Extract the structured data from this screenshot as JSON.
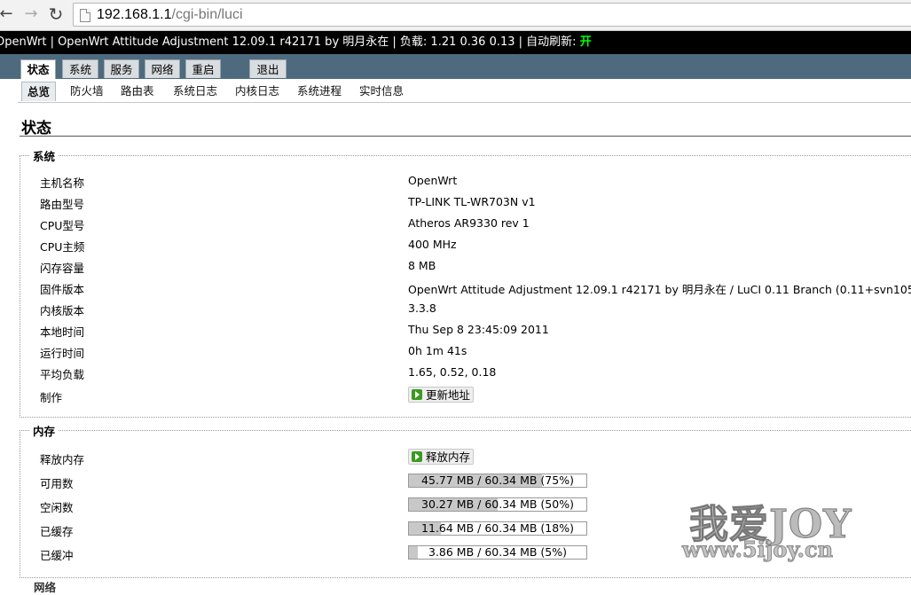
{
  "browser": {
    "url_host": "192.168.1.1",
    "url_path": "/cgi-bin/luci",
    "back_glyph": "←",
    "forward_glyph": "→",
    "reload_glyph": "↻"
  },
  "header": {
    "text": "OpenWrt | OpenWrt Attitude Adjustment 12.09.1 r42171 by 明月永在 | 负载: 1.21 0.36 0.13 | 自动刷新: ",
    "refresh_state": "开"
  },
  "menu": {
    "tabs": [
      {
        "label": "状态"
      },
      {
        "label": "系统"
      },
      {
        "label": "服务"
      },
      {
        "label": "网络"
      },
      {
        "label": "重启"
      },
      {
        "label": "退出"
      }
    ]
  },
  "submenu": {
    "tabs": [
      {
        "label": "总览"
      },
      {
        "label": "防火墙"
      },
      {
        "label": "路由表"
      },
      {
        "label": "系统日志"
      },
      {
        "label": "内核日志"
      },
      {
        "label": "系统进程"
      },
      {
        "label": "实时信息"
      }
    ]
  },
  "page": {
    "title": "状态"
  },
  "system": {
    "legend": "系统",
    "rows": [
      {
        "label": "主机名称",
        "value": "OpenWrt"
      },
      {
        "label": "路由型号",
        "value": "TP-LINK TL-WR703N v1"
      },
      {
        "label": "CPU型号",
        "value": "Atheros AR9330 rev 1"
      },
      {
        "label": "CPU主频",
        "value": "400 MHz"
      },
      {
        "label": "闪存容量",
        "value": "8 MB"
      },
      {
        "label": "固件版本",
        "value": "OpenWrt Attitude Adjustment 12.09.1 r42171 by 明月永在 / LuCI 0.11 Branch (0.11+svn105"
      },
      {
        "label": "内核版本",
        "value": "3.3.8"
      },
      {
        "label": "本地时间",
        "value": "Thu Sep 8 23:45:09 2011"
      },
      {
        "label": "运行时间",
        "value": "0h 1m 41s"
      },
      {
        "label": "平均负载",
        "value": "1.65, 0.52, 0.18"
      },
      {
        "label": "制作",
        "button": "更新地址"
      }
    ]
  },
  "memory": {
    "legend": "内存",
    "release_label": "释放内存",
    "release_button": "释放内存",
    "rows": [
      {
        "label": "可用数",
        "text": "45.77 MB / 60.34 MB (75%)",
        "fraction": 0.75
      },
      {
        "label": "空闲数",
        "text": "30.27 MB / 60.34 MB (50%)",
        "fraction": 0.5
      },
      {
        "label": "已缓存",
        "text": "11.64 MB / 60.34 MB (18%)",
        "fraction": 0.18
      },
      {
        "label": "已缓冲",
        "text": "3.86 MB / 60.34 MB (5%)",
        "fraction": 0.05
      }
    ]
  },
  "next_section": {
    "legend": "网络"
  },
  "watermark": {
    "big": "我爱JOY",
    "small": "www.5ijoy.cn"
  }
}
